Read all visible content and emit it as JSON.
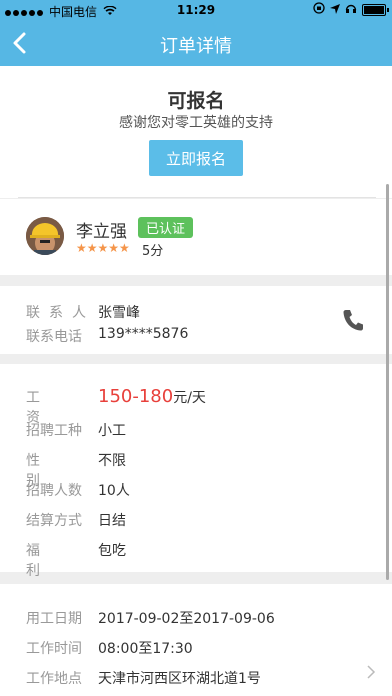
{
  "status_bar": {
    "carrier": "中国电信",
    "time": "11:29"
  },
  "nav": {
    "title": "订单详情"
  },
  "signup": {
    "headline": "可报名",
    "thanks": "感谢您对零工英雄的支持",
    "button": "立即报名"
  },
  "profile": {
    "name": "李立强",
    "badge": "已认证",
    "stars": "★★★★★",
    "score": "5分"
  },
  "contact": {
    "person_label": "联系人",
    "person_value": "张雪峰",
    "phone_label": "联系电话",
    "phone_value": "139****5876"
  },
  "job": {
    "wage_label": "工资",
    "wage_value": "150-180",
    "wage_unit": "元/天",
    "type_label": "招聘工种",
    "type_value": "小工",
    "gender_label": "性别",
    "gender_value": "不限",
    "count_label": "招聘人数",
    "count_value": "10人",
    "settle_label": "结算方式",
    "settle_value": "日结",
    "welfare_label": "福利",
    "welfare_value": "包吃"
  },
  "work": {
    "date_label": "用工日期",
    "date_value": "2017-09-02至2017-09-06",
    "time_label": "工作时间",
    "time_value": "08:00至17:30",
    "place_label": "工作地点",
    "place_value": "天津市河西区环湖北道1号"
  },
  "colors": {
    "accent": "#56b7e4",
    "wage": "#e8403b",
    "badge": "#5dc15c",
    "stars": "#f5954a"
  }
}
